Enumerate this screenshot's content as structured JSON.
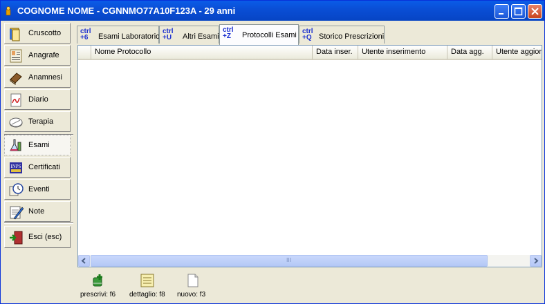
{
  "window": {
    "title": "COGNOME NOME - CGNNMO77A10F123A - 29 anni",
    "controls": [
      "minimize",
      "maximize",
      "close"
    ]
  },
  "sidebar": {
    "items": [
      {
        "label": "Cruscotto",
        "icon": "dashboard-book-icon"
      },
      {
        "label": "Anagrafe",
        "icon": "registry-icon"
      },
      {
        "label": "Anamnesi",
        "icon": "history-book-icon"
      },
      {
        "label": "Diario",
        "icon": "diary-icon"
      },
      {
        "label": "Terapia",
        "icon": "pill-icon"
      },
      {
        "label": "Esami",
        "icon": "lab-flask-icon",
        "active": true
      },
      {
        "label": "Certificati",
        "icon": "certificate-icon"
      },
      {
        "label": "Eventi",
        "icon": "clock-icon"
      },
      {
        "label": "Note",
        "icon": "note-pencil-icon"
      }
    ],
    "exit": {
      "label": "Esci (esc)",
      "icon": "exit-door-icon"
    }
  },
  "tabs": [
    {
      "shortcut_line1": "ctrl",
      "shortcut_line2": "+6",
      "label": "Esami Laboratorio"
    },
    {
      "shortcut_line1": "ctrl",
      "shortcut_line2": "+U",
      "label": "Altri Esami"
    },
    {
      "shortcut_line1": "ctrl",
      "shortcut_line2": "+Z",
      "label": "Protocolli Esami",
      "active": true
    },
    {
      "shortcut_line1": "ctrl",
      "shortcut_line2": "+Q",
      "label": "Storico Prescrizioni"
    }
  ],
  "grid": {
    "columns": [
      "Nome Protocollo",
      "Data inser.",
      "Utente inserimento",
      "Data agg.",
      "Utente aggior"
    ],
    "rows": [],
    "scroll_grip": "III"
  },
  "actions": [
    {
      "label": "prescrivi: f6",
      "icon": "prescribe-icon"
    },
    {
      "label": "dettaglio: f8",
      "icon": "detail-icon"
    },
    {
      "label": "nuovo: f3",
      "icon": "new-document-icon"
    }
  ],
  "colors": {
    "title_bar": "#0a4fd6",
    "window_bg": "#ece9d8",
    "shortcut_text": "#1a2fd0",
    "scrollbar": "#c1d3fb"
  }
}
